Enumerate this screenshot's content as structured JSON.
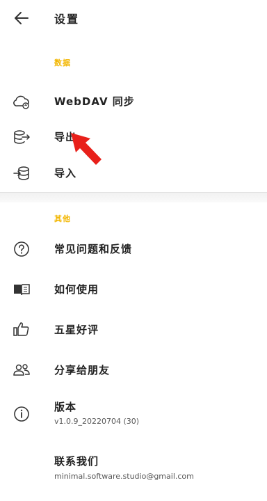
{
  "header": {
    "title": "设置",
    "back_icon": "arrow-left-icon"
  },
  "sections": [
    {
      "title": "数据",
      "title_color": "#f2b600",
      "items": [
        {
          "label": "WebDAV 同步",
          "icon": "cloud-sync-icon"
        },
        {
          "label": "导出",
          "icon": "database-export-icon"
        },
        {
          "label": "导入",
          "icon": "database-import-icon"
        }
      ]
    },
    {
      "title": "其他",
      "title_color": "#f2b600",
      "items": [
        {
          "label": "常见问题和反馈",
          "icon": "help-circle-icon"
        },
        {
          "label": "如何使用",
          "icon": "book-icon"
        },
        {
          "label": "五星好评",
          "icon": "thumb-up-icon"
        },
        {
          "label": "分享给朋友",
          "icon": "people-icon"
        },
        {
          "label": "版本",
          "sub": "v1.0.9_20220704 (30)",
          "icon": "info-icon"
        },
        {
          "label": "联系我们",
          "sub": "minimal.software.studio@gmail.com"
        }
      ]
    }
  ],
  "annotation": {
    "icon": "red-arrow-annotation",
    "color": "#e8201a"
  }
}
